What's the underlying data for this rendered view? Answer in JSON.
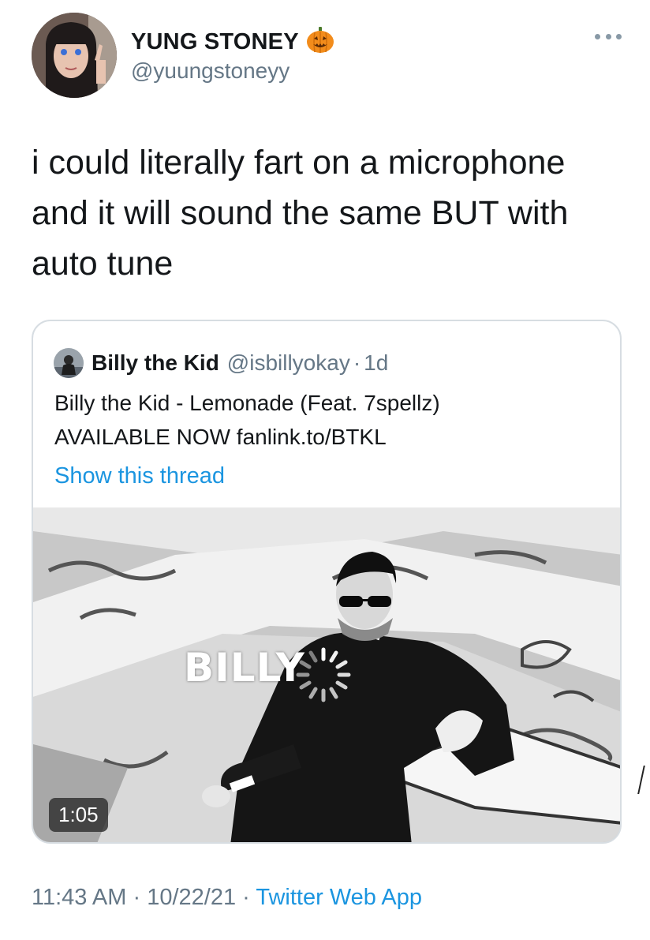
{
  "author": {
    "display_name": "YUNG STONEY",
    "emoji": "🎃",
    "handle": "@yuungstoneyy"
  },
  "tweet": {
    "lines": [
      "i could literally fart on a microphone",
      "and it will sound the same BUT with",
      "auto tune"
    ]
  },
  "quoted": {
    "display_name": "Billy the Kid",
    "handle": "@isbillyokay",
    "separator": "·",
    "time": "1d",
    "text_line1": "Billy the Kid - Lemonade (Feat. 7spellz)",
    "text_line2": "AVAILABLE NOW fanlink.to/BTKL",
    "show_thread": "Show this thread",
    "video": {
      "overlay_text": "BILLY",
      "duration": "1:05"
    }
  },
  "footer": {
    "time": "11:43 AM",
    "sep1": "·",
    "date": "10/22/21",
    "sep2": "·",
    "app": "Twitter Web App"
  },
  "colors": {
    "link": "#1b95e0",
    "secondary_text": "#657786",
    "border": "#d7dde2"
  },
  "icons": {
    "more": "more-horizontal-icon",
    "spinner": "loading-spinner-icon"
  }
}
